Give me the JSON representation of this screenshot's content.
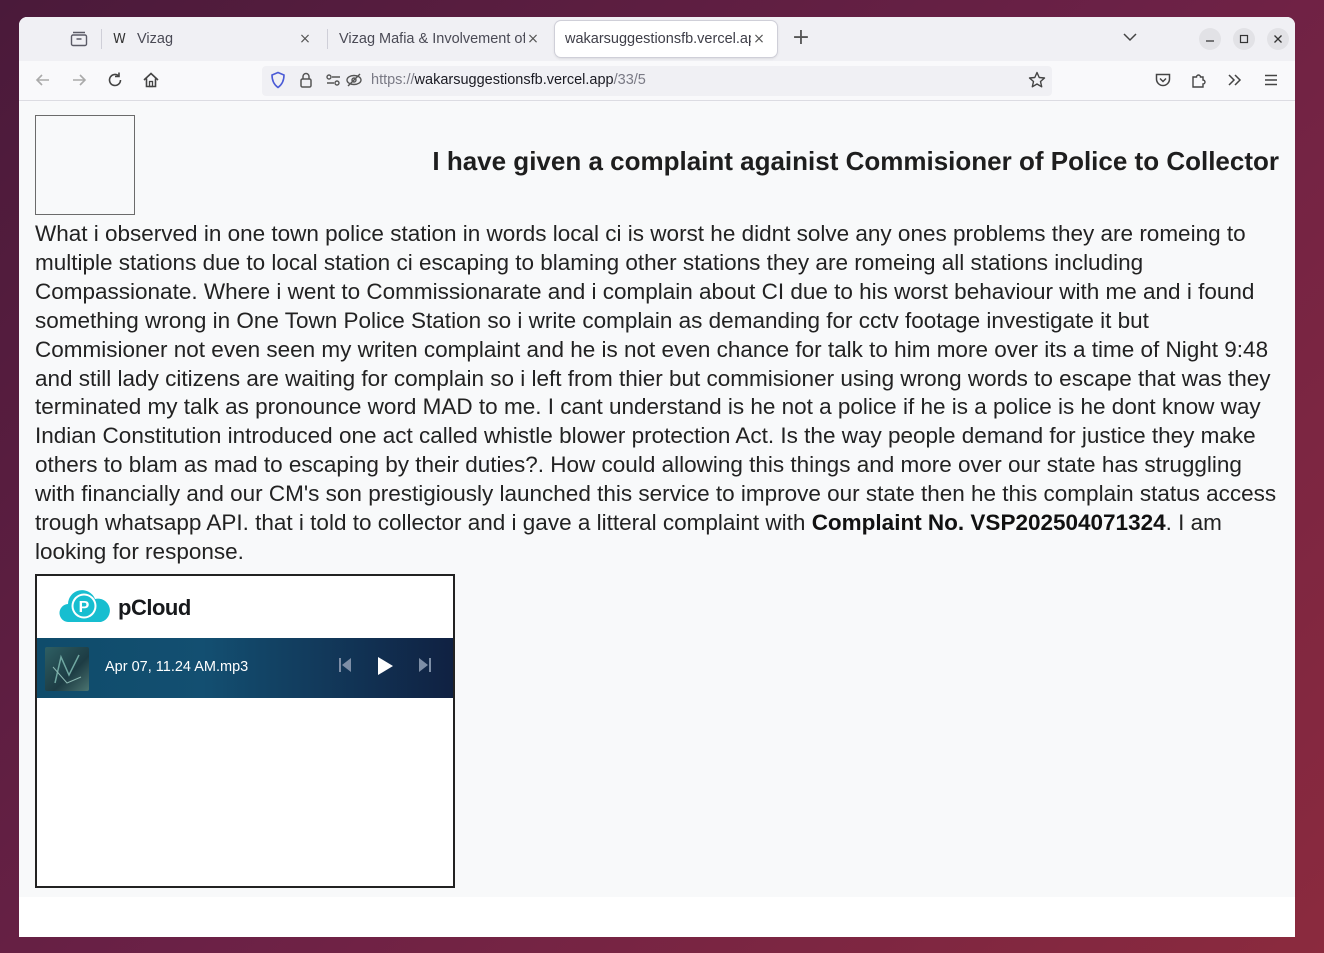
{
  "browser": {
    "tabs": [
      {
        "favicon": "vercel-w-icon",
        "title": "Vizag",
        "close": "×"
      },
      {
        "favicon": "none",
        "title": "Vizag Mafia & Involvement of",
        "close": "×"
      },
      {
        "favicon": "none",
        "title": "wakarsuggestionsfb.vercel.app",
        "close": "×"
      }
    ],
    "new_tab": "+",
    "url_scheme": "https://",
    "url_host": "wakarsuggestionsfb.vercel.app",
    "url_path": "/33/5"
  },
  "page": {
    "heading": "I have given a complaint againist Commisioner of Police to Collector",
    "body_before": "What i observed in one town police station in words local ci is worst he didnt solve any ones problems they are romeing to multiple stations due to local station ci escaping to blaming other stations they are romeing all stations including Compassionate. Where i went to Commissionarate and i complain about CI due to his worst behaviour with me and i found something wrong in One Town Police Station so i write complain as demanding for cctv footage investigate it but Commisioner not even seen my writen complaint and he is not even chance for talk to him more over its a time of Night 9:48 and still lady citizens are waiting for complain so i left from thier but commisioner using wrong words to escape that was they terminated my talk as pronounce word MAD to me. I cant understand is he not a police if he is a police is he dont know way Indian Constitution introduced one act called whistle blower protection Act. Is the way people demand for justice they make others to blam as mad to escaping by their duties?. How could allowing this things and more over our state has struggling with financially and our CM's son prestigiously launched this service to improve our state then he this complain status access trough whatsapp API. that i told to collector and i gave a litteral complaint with ",
    "complaint_no": "Complaint No. VSP202504071324",
    "body_after": ". I am looking for response."
  },
  "pcloud": {
    "brand": "pCloud",
    "logo_letter": "P",
    "file_name": "Apr 07, 11.24 AM.mp3"
  },
  "colors": {
    "pcloud_accent": "#17bed0",
    "player_bg_start": "#0f4c6b",
    "player_bg_end": "#102142"
  }
}
